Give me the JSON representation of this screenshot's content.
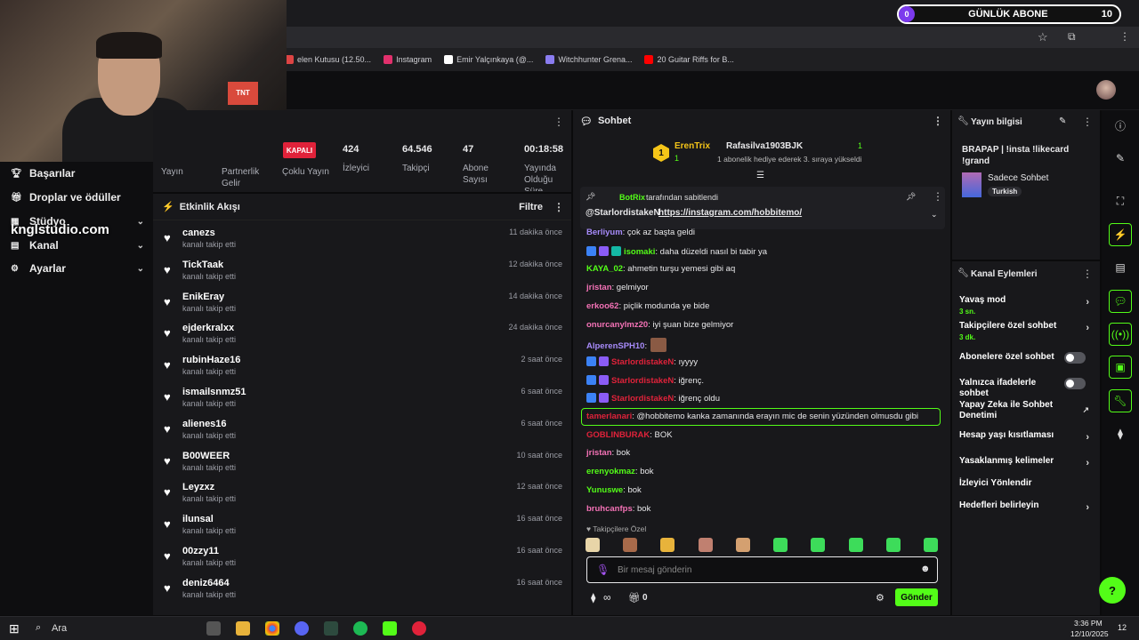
{
  "browser": {
    "bookmarks": [
      {
        "label": "elen Kutusu (12.50...",
        "color": "#d44"
      },
      {
        "label": "Instagram",
        "color": "#e1306c"
      },
      {
        "label": "Emir Yalçınkaya (@...",
        "color": "#fff"
      },
      {
        "label": "Witchhunter Grena...",
        "color": "#8a7cf0"
      },
      {
        "label": "20 Guitar Riffs for B...",
        "color": "#f00"
      }
    ],
    "accent": "#53fc18"
  },
  "webcam": {
    "tnt_label": "TNT"
  },
  "sub_goal": {
    "current": "0",
    "label": "GÜNLÜK ABONE",
    "target": "10"
  },
  "watermark": "knglstudio.com",
  "sidebar": {
    "items": [
      {
        "label": "Başarılar",
        "icon": "trophy-icon"
      },
      {
        "label": "Droplar ve ödüller",
        "icon": "gift-icon"
      },
      {
        "label": "Stüdyo",
        "icon": "grid-icon",
        "chev": "⌄"
      },
      {
        "label": "Kanal",
        "icon": "channel-icon",
        "chev": "⌄"
      },
      {
        "label": "Ayarlar",
        "icon": "gear-icon",
        "chev": "⌄"
      }
    ]
  },
  "stats": {
    "status": "KAPALI",
    "left_labels": [
      "Yayın",
      "Partnerlik Gelir",
      "Çoklu Yayın"
    ],
    "items": [
      {
        "value": "424",
        "label": "İzleyici"
      },
      {
        "value": "64.546",
        "label": "Takipçi"
      },
      {
        "value": "47",
        "label": "Abone Sayısı"
      },
      {
        "value": "00:18:58",
        "label": "Yayında Olduğu Süre"
      }
    ]
  },
  "activity": {
    "title": "Etkinlik Akışı",
    "filter": "Filtre",
    "events": [
      {
        "name": "canezs",
        "sub": "kanalı takip etti",
        "time": "11 dakika önce"
      },
      {
        "name": "TickTaak",
        "sub": "kanalı takip etti",
        "time": "12 dakika önce"
      },
      {
        "name": "EnikEray",
        "sub": "kanalı takip etti",
        "time": "14 dakika önce"
      },
      {
        "name": "ejderkralxx",
        "sub": "kanalı takip etti",
        "time": "24 dakika önce"
      },
      {
        "name": "rubinHaze16",
        "sub": "kanalı takip etti",
        "time": "2 saat önce"
      },
      {
        "name": "ismailsnmz51",
        "sub": "kanalı takip etti",
        "time": "6 saat önce"
      },
      {
        "name": "alienes16",
        "sub": "kanalı takip etti",
        "time": "6 saat önce"
      },
      {
        "name": "B00WEER",
        "sub": "kanalı takip etti",
        "time": "10 saat önce"
      },
      {
        "name": "Leyzxz",
        "sub": "kanalı takip etti",
        "time": "12 saat önce"
      },
      {
        "name": "ilunsal",
        "sub": "kanalı takip etti",
        "time": "16 saat önce"
      },
      {
        "name": "00zzy11",
        "sub": "kanalı takip etti",
        "time": "16 saat önce"
      },
      {
        "name": "deniz6464",
        "sub": "kanalı takip etti",
        "time": "16 saat önce"
      }
    ]
  },
  "chat": {
    "title": "Sohbet",
    "leader": {
      "rank": "1",
      "name": "ErenTrix",
      "count": "1",
      "gifter": "Rafasilva1903BJK",
      "gifter_count": "1",
      "note": "1 abonelik hediye ederek 3. sıraya yükseldi"
    },
    "pinned": {
      "by": "BotRix",
      "by_suffix": "tarafından sabitlendi",
      "mention": "@StarlordistakeN",
      "link": "https://instagram.com/hobbitemo/"
    },
    "messages": [
      {
        "user": "Berliyum",
        "color": "#a78bfa",
        "text": ": çok az başta geldi",
        "badges": 0
      },
      {
        "user": "isomaki",
        "color": "#53fc18",
        "text": ": daha düzeldi nasıl bi tabir ya",
        "badges": 3
      },
      {
        "user": "KAYA_02",
        "color": "#53fc18",
        "text": ": ahmetin turşu yemesi gibi aq",
        "badges": 0
      },
      {
        "user": "jristan",
        "color": "#f472b6",
        "text": ": gelmiyor",
        "badges": 0
      },
      {
        "user": "erkoo62",
        "color": "#f472b6",
        "text": ": piçlik modunda ye bide",
        "badges": 0
      },
      {
        "user": "onurcanylmz20",
        "color": "#f472b6",
        "text": ": iyi şuan bize gelmiyor",
        "badges": 0
      },
      {
        "user": "AlperenSPH10",
        "color": "#a78bfa",
        "text": ":",
        "badges": 0
      },
      {
        "user": "StarlordistakeN",
        "color": "#e0223a",
        "text": ": ıyyyy",
        "badges": 2
      },
      {
        "user": "StarlordistakeN",
        "color": "#e0223a",
        "text": ": iğrenç.",
        "badges": 2
      },
      {
        "user": "StarlordistakeN",
        "color": "#e0223a",
        "text": ": iğrenç oldu",
        "badges": 2
      },
      {
        "user": "tamerlanari",
        "color": "#e0223a",
        "text": ": @hobbitemo kanka zamanında erayın mic de senin yüzünden olmusdu gibi",
        "badges": 0
      },
      {
        "user": "GOBLINBURAK",
        "color": "#e0223a",
        "text": ": BOK",
        "badges": 0
      },
      {
        "user": "jristan",
        "color": "#f472b6",
        "text": ": bok",
        "badges": 0
      },
      {
        "user": "erenyokmaz",
        "color": "#53fc18",
        "text": ": bok",
        "badges": 0
      },
      {
        "user": "Yunuswe",
        "color": "#53fc18",
        "text": ": bok",
        "badges": 0
      },
      {
        "user": "bruhcanfps",
        "color": "#f472b6",
        "text": ": bok",
        "badges": 0
      }
    ],
    "followers_only": "Takipçilere Özel",
    "placeholder": "Bir mesaj gönderin",
    "points_value": "∞",
    "gift_count": "0",
    "send": "Gönder"
  },
  "stream_info": {
    "title": "Yayın bilgisi",
    "stream_title": "BRAPAP | !insta !likecard !grand",
    "category": "Sadece Sohbet",
    "tag": "Turkish"
  },
  "channel_actions": {
    "title": "Kanal Eylemleri",
    "items": [
      {
        "label": "Yavaş mod",
        "sub": "3 sn.",
        "type": "chev"
      },
      {
        "label": "Takipçilere özel sohbet",
        "sub": "3 dk.",
        "type": "chev"
      },
      {
        "label": "Abonelere özel sohbet",
        "sub": "",
        "type": "toggle"
      },
      {
        "label": "Yalnızca ifadelerle sohbet",
        "sub": "",
        "type": "toggle"
      },
      {
        "label": "Yapay Zeka ile Sohbet Denetimi",
        "sub": "",
        "type": "ext"
      },
      {
        "label": "Hesap yaşı kısıtlaması",
        "sub": "",
        "type": "chev"
      },
      {
        "label": "Yasaklanmış kelimeler",
        "sub": "",
        "type": "chev"
      },
      {
        "label": "İzleyici Yönlendir",
        "sub": "",
        "type": "none"
      },
      {
        "label": "Hedefleri belirleyin",
        "sub": "",
        "type": "chev"
      }
    ]
  },
  "taskbar": {
    "search": "Ara",
    "time": "3:36 PM",
    "date": "12/10/2025",
    "notif": "12"
  }
}
